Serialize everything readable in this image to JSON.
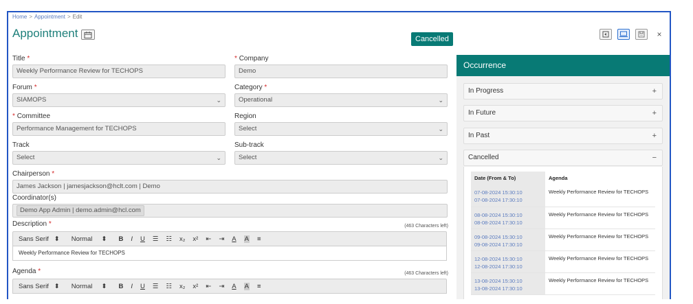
{
  "breadcrumb": {
    "home": "Home",
    "section": "Appointment",
    "current": "Edit"
  },
  "page": {
    "title": "Appointment",
    "status": "Cancelled"
  },
  "form": {
    "title": {
      "label": "Title",
      "value": "Weekly Performance Review for TECHOPS"
    },
    "company": {
      "label": "Company",
      "value": "Demo"
    },
    "forum": {
      "label": "Forum",
      "value": "SIAMOPS"
    },
    "category": {
      "label": "Category",
      "value": "Operational"
    },
    "committee": {
      "label": "Committee",
      "value": "Performance Management for TECHOPS"
    },
    "region": {
      "label": "Region",
      "value": "Select"
    },
    "track": {
      "label": "Track",
      "value": "Select"
    },
    "subtrack": {
      "label": "Sub-track",
      "value": "Select"
    },
    "chairperson": {
      "label": "Chairperson",
      "value": "James Jackson | jamesjackson@hclt.com | Demo"
    },
    "coordinators": {
      "label": "Coordinator(s)",
      "value": "Demo App Admin | demo.admin@hcl.com"
    },
    "description": {
      "label": "Description",
      "chars_left": "(463 Characters left)",
      "content": "Weekly Performance Review for TECHOPS"
    },
    "agenda": {
      "label": "Agenda",
      "chars_left": "(463 Characters left)"
    }
  },
  "editor_toolbar": {
    "font": "Sans Serif",
    "size": "Normal",
    "bold": "B",
    "italic": "I",
    "underline": "U",
    "ordered_list": "☰",
    "bullet_list": "☷",
    "subscript": "x₂",
    "superscript": "x²",
    "outdent": "⇤",
    "indent": "⇥",
    "font_color": "A",
    "bg_color": "A",
    "align": "≡",
    "select_arrow": "⬍"
  },
  "occurrence": {
    "title": "Occurrence",
    "sections": [
      {
        "label": "In Progress",
        "sign": "+"
      },
      {
        "label": "In Future",
        "sign": "+"
      },
      {
        "label": "In Past",
        "sign": "+"
      },
      {
        "label": "Cancelled",
        "sign": "−"
      }
    ],
    "table": {
      "headers": [
        "Date (From & To)",
        "Agenda"
      ],
      "rows": [
        {
          "from": "07-08-2024 15:30:10",
          "to": "07-08-2024 17:30:10",
          "agenda": "Weekly Performance Review for TECHOPS"
        },
        {
          "from": "08-08-2024 15:30:10",
          "to": "08-08-2024 17:30:10",
          "agenda": "Weekly Performance Review for TECHOPS"
        },
        {
          "from": "09-08-2024 15:30:10",
          "to": "09-08-2024 17:30:10",
          "agenda": "Weekly Performance Review for TECHOPS"
        },
        {
          "from": "12-08-2024 15:30:10",
          "to": "12-08-2024 17:30:10",
          "agenda": "Weekly Performance Review for TECHOPS"
        },
        {
          "from": "13-08-2024 15:30:10",
          "to": "13-08-2024 17:30:10",
          "agenda": "Weekly Performance Review for TECHOPS"
        }
      ]
    }
  },
  "colors": {
    "accent": "#087a75",
    "title": "#1e7f7a",
    "border": "#2155c4",
    "link": "#5a7bbf",
    "required": "#d42a2a"
  }
}
